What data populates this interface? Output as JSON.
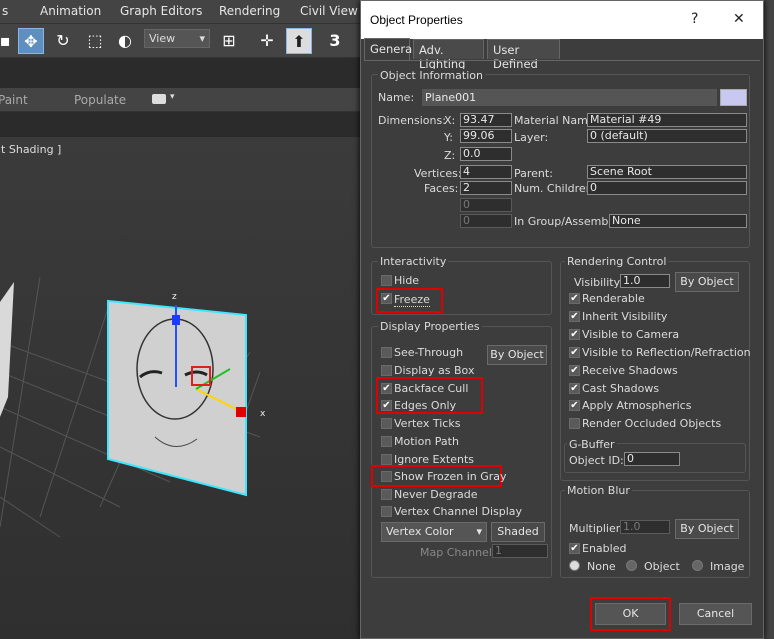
{
  "menu": [
    "s",
    "Animation",
    "Graph Editors",
    "Rendering",
    "Civil View"
  ],
  "toolbar": {
    "view_label": "View",
    "three_label": "3"
  },
  "ribbon": {
    "paint": "Paint",
    "populate": "Populate"
  },
  "viewport": {
    "label": "lt Shading ]",
    "axis_x": "x",
    "axis_z": "z"
  },
  "dialog": {
    "title": "Object Properties",
    "help": "?",
    "close": "✕",
    "tabs": [
      "General",
      "Adv. Lighting",
      "User Defined"
    ],
    "object_info": {
      "title": "Object Information",
      "name_label": "Name:",
      "name_value": "Plane001",
      "color": "#c8c8f0",
      "dimensions_label": "Dimensions:",
      "x_label": "X:",
      "x_value": "93.47",
      "y_label": "Y:",
      "y_value": "99.06",
      "z_label": "Z:",
      "z_value": "0.0",
      "vertices_label": "Vertices:",
      "vertices_value": "4",
      "faces_label": "Faces:",
      "faces_value": "2",
      "blank1": "0",
      "blank2": "0",
      "material_label": "Material Name:",
      "material_value": "Material #49",
      "layer_label": "Layer:",
      "layer_value": "0 (default)",
      "parent_label": "Parent:",
      "parent_value": "Scene Root",
      "children_label": "Num. Children:",
      "children_value": "0",
      "group_label": "In Group/Assembly:",
      "group_value": "None"
    },
    "interactivity": {
      "title": "Interactivity",
      "hide": "Hide",
      "freeze": "Freeze"
    },
    "display": {
      "title": "Display Properties",
      "by_object": "By Object",
      "items": [
        "See-Through",
        "Display as Box",
        "Backface Cull",
        "Edges Only",
        "Vertex Ticks",
        "Motion Path",
        "Ignore Extents",
        "Show Frozen in Gray",
        "Never Degrade",
        "Vertex Channel Display"
      ],
      "vertex_color": "Vertex Color",
      "shaded": "Shaded",
      "map_channel_label": "Map Channel:",
      "map_channel_value": "1"
    },
    "rendering": {
      "title": "Rendering Control",
      "visibility_label": "Visibility:",
      "visibility_value": "1.0",
      "by_object": "By Object",
      "items": [
        "Renderable",
        "Inherit Visibility",
        "Visible to Camera",
        "Visible to Reflection/Refraction",
        "Receive Shadows",
        "Cast Shadows",
        "Apply Atmospherics",
        "Render Occluded Objects"
      ]
    },
    "gbuffer": {
      "title": "G-Buffer",
      "object_id_label": "Object ID:",
      "object_id_value": "0"
    },
    "motion_blur": {
      "title": "Motion Blur",
      "multiplier_label": "Multiplier:",
      "multiplier_value": "1.0",
      "by_object": "By Object",
      "enabled": "Enabled",
      "radio": [
        "None",
        "Object",
        "Image"
      ]
    },
    "ok": "OK",
    "cancel": "Cancel"
  }
}
